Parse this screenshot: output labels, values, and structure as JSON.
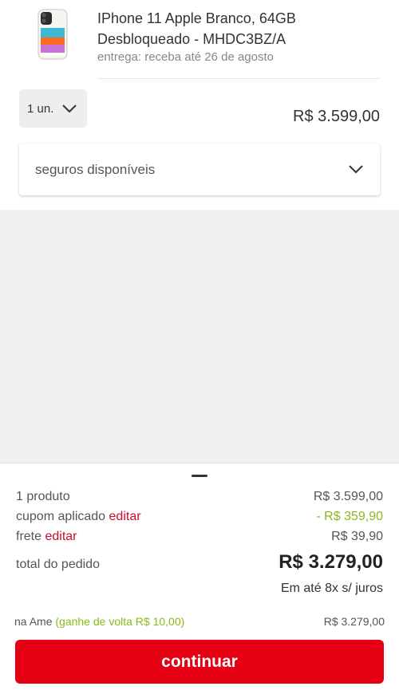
{
  "product": {
    "title": "IPhone 11 Apple Branco, 64GB Desbloqueado - MHDC3BZ/A",
    "delivery": "entrega: receba até 26 de agosto",
    "image_icon": "iphone-white-icon"
  },
  "quantity": {
    "label": "1 un.",
    "icon": "chevron-down-icon"
  },
  "price": "R$ 3.599,00",
  "insurance": {
    "label": "seguros disponíveis",
    "icon": "chevron-down-icon"
  },
  "summary": {
    "products_label": "1 produto",
    "products_value": "R$ 3.599,00",
    "coupon_label": "cupom aplicado",
    "coupon_edit": "editar",
    "coupon_value": "- R$ 359,90",
    "shipping_label": "frete",
    "shipping_edit": "editar",
    "shipping_value": "R$ 39,90",
    "total_label": "total do pedido",
    "total_value": "R$ 3.279,00",
    "installments": "Em até 8x s/ juros",
    "ame_label": "na Ame",
    "ame_bonus": "(ganhe de volta R$ 10,00)",
    "ame_value": "R$ 3.279,00"
  },
  "continue_label": "continuar",
  "colors": {
    "brand_red": "#e60014",
    "link_red": "#cc0c2f",
    "discount_green": "#8ab91a"
  }
}
